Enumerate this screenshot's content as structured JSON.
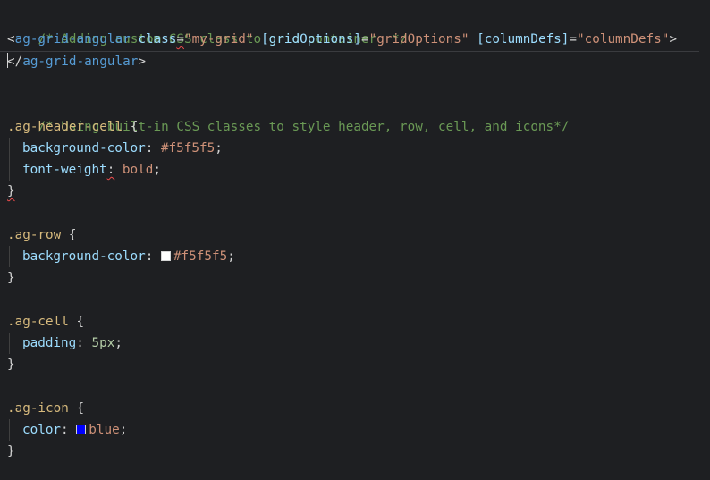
{
  "editor": {
    "comment1": "/* Adding custom CSS class to grid container  */",
    "open_tag": {
      "lt": "<",
      "tag": "ag-grid-angular",
      "attr_class": "class",
      "eq": "=",
      "class_value": "\"my-grid\"",
      "attr_grid_options": "[gridOptions]",
      "grid_options_value": "\"gridOptions\"",
      "attr_column_defs": "[columnDefs]",
      "column_defs_value": "\"columnDefs\"",
      "gt": ">"
    },
    "close_tag": {
      "lt": "<",
      "slash": "/",
      "tag": "ag-grid-angular",
      "gt": ">"
    },
    "comment2": "/* Using built-in CSS classes to style header, row, cell, and icons*/",
    "rules": [
      {
        "selector": ".ag-header-cell",
        "decls": [
          {
            "prop": "background-color",
            "value": "#f5f5f5"
          },
          {
            "prop": "font-weight",
            "value": "bold"
          }
        ]
      },
      {
        "selector": ".ag-row",
        "decls": [
          {
            "prop": "background-color",
            "value": "#f5f5f5",
            "swatch": "#ffffff"
          }
        ]
      },
      {
        "selector": ".ag-cell",
        "decls": [
          {
            "prop": "padding",
            "value": "5px"
          }
        ]
      },
      {
        "selector": ".ag-icon",
        "decls": [
          {
            "prop": "color",
            "value": "blue",
            "swatch": "#0000ff"
          }
        ]
      }
    ],
    "open_brace": "{",
    "close_brace": "}",
    "colon": ":",
    "semicolon": ";"
  }
}
